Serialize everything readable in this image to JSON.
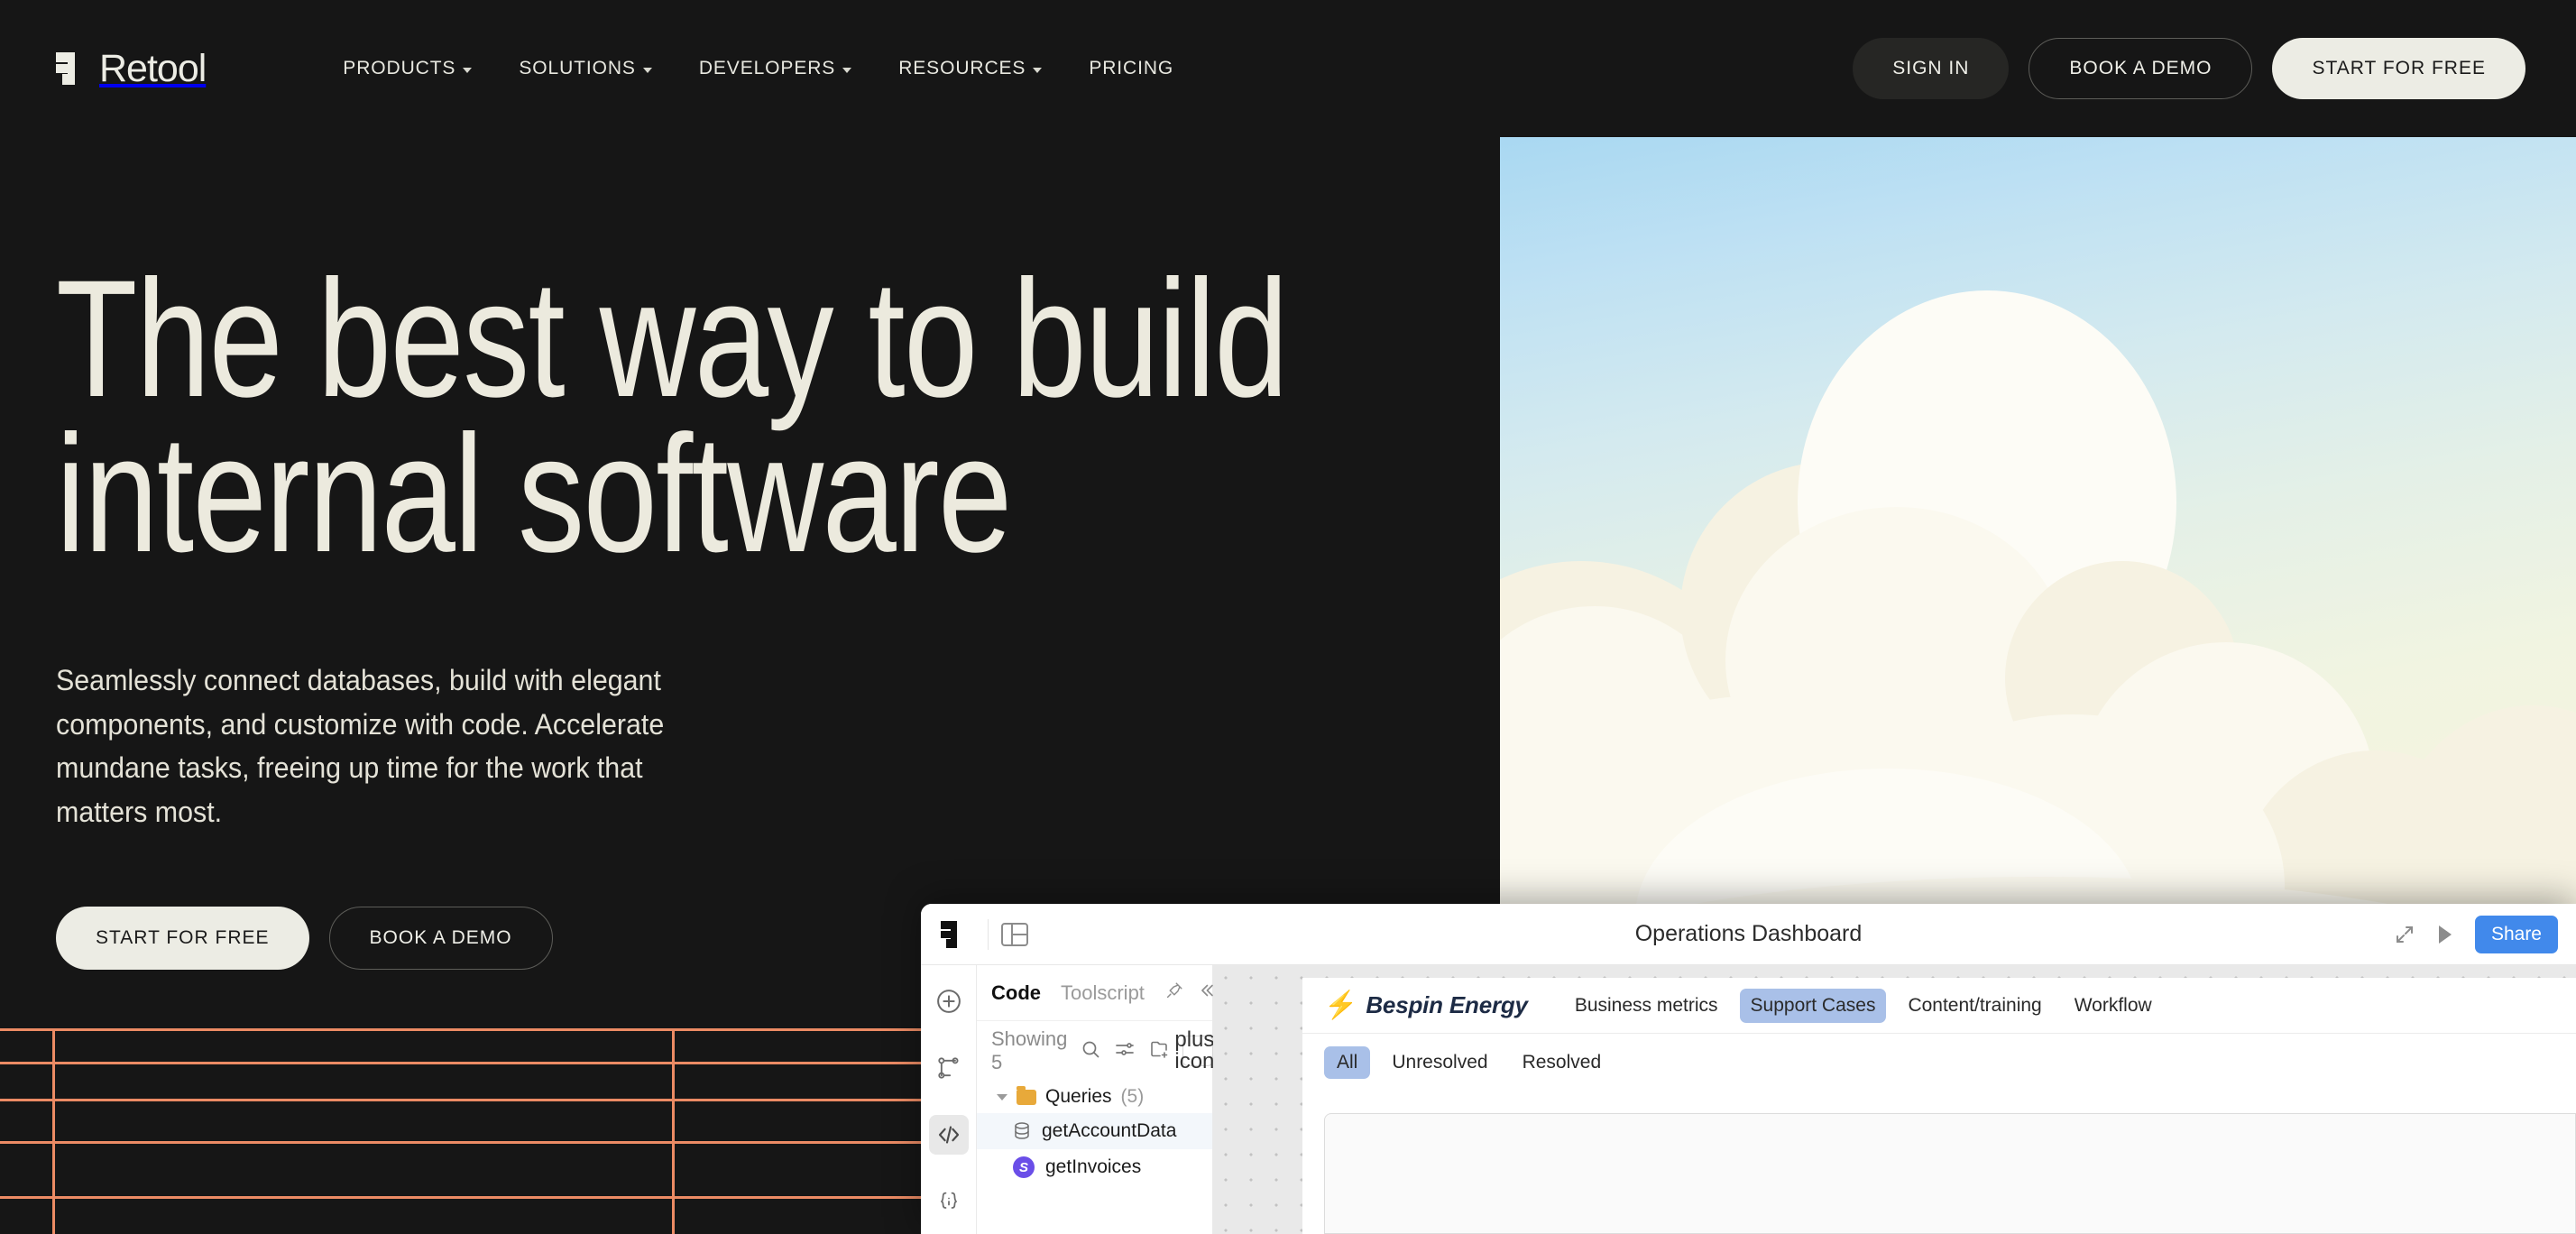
{
  "site": {
    "logo_text": "Retool",
    "logo_mark": "retool-logo-icon"
  },
  "nav": {
    "items": [
      {
        "label": "PRODUCTS",
        "has_dropdown": true
      },
      {
        "label": "SOLUTIONS",
        "has_dropdown": true
      },
      {
        "label": "DEVELOPERS",
        "has_dropdown": true
      },
      {
        "label": "RESOURCES",
        "has_dropdown": true
      },
      {
        "label": "PRICING",
        "has_dropdown": false
      }
    ],
    "sign_in": "SIGN IN",
    "book_demo": "BOOK A DEMO",
    "start_free": "START FOR FREE"
  },
  "hero": {
    "heading_line1": "The best way to build",
    "heading_line2": "internal software",
    "subtext": "Seamlessly connect databases, build with elegant components, and customize with code. Accelerate mundane tasks, freeing up time for the work that matters most.",
    "cta_primary": "START FOR FREE",
    "cta_secondary": "BOOK A DEMO"
  },
  "app": {
    "title": "Operations Dashboard",
    "share_label": "Share",
    "panel_toggle_icon": "panel-layout-icon",
    "expand_icon": "expand-arrows-icon",
    "run_icon": "play-icon",
    "rail": [
      {
        "name": "add-icon",
        "glyph": "+"
      },
      {
        "name": "workflow-icon",
        "glyph": ""
      },
      {
        "name": "code-icon",
        "glyph": "</>",
        "selected": true
      },
      {
        "name": "state-icon",
        "glyph": "{i}"
      }
    ],
    "code_panel": {
      "tab_code": "Code",
      "tab_toolscript": "Toolscript",
      "pin_icon": "pin-icon",
      "collapse_icon": "collapse-left-icon",
      "showing_label": "Showing 5",
      "search_icon": "search-icon",
      "filter_icon": "filter-icon",
      "new_folder_icon": "new-folder-icon",
      "add_icon": "plus-icon",
      "folder_label": "Queries",
      "folder_count": "(5)",
      "items": [
        {
          "label": "getAccountData",
          "icon": "database-icon",
          "selected": true
        },
        {
          "label": "getInvoices",
          "icon": "stripe-icon",
          "selected": false
        }
      ]
    }
  },
  "bespin": {
    "brand": "Bespin Energy",
    "brand_icon": "lightning-bolt-icon",
    "tabs": [
      {
        "label": "Business metrics",
        "active": false
      },
      {
        "label": "Support Cases",
        "active": true
      },
      {
        "label": "Content/training",
        "active": false
      },
      {
        "label": "Workflow",
        "active": false
      }
    ],
    "filters": [
      {
        "label": "All",
        "active": true
      },
      {
        "label": "Unresolved",
        "active": false
      },
      {
        "label": "Resolved",
        "active": false
      }
    ]
  },
  "colors": {
    "page_bg": "#161616",
    "cream": "#ecece4",
    "grid_line": "#ec8b64",
    "share_blue": "#4189eb",
    "tab_active_blue": "#a9c0e8",
    "folder_amber": "#e8a93a",
    "stripe_purple": "#6a4ee8"
  }
}
